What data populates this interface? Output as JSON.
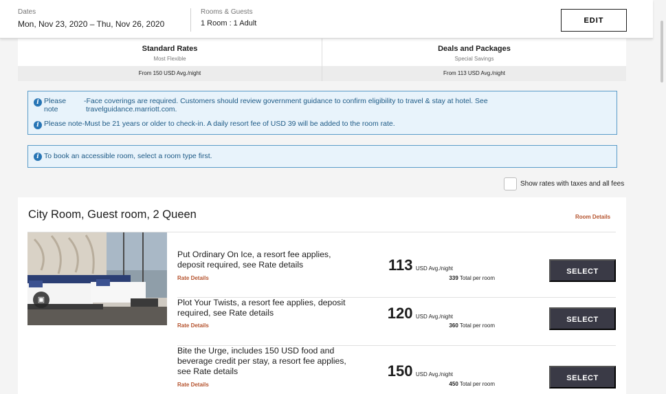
{
  "header": {
    "dates_label": "Dates",
    "dates_value": "Mon, Nov 23, 2020 – Thu, Nov 26, 2020",
    "rooms_label": "Rooms & Guests",
    "rooms_value": "1 Room : 1 Adult",
    "edit_label": "EDIT"
  },
  "tabs": [
    {
      "title": "Standard Rates",
      "subtitle": "Most Flexible",
      "from": "From 150 USD Avg./night"
    },
    {
      "title": "Deals and Packages",
      "subtitle": "Special Savings",
      "from": "From 113 USD Avg./night"
    }
  ],
  "notices": {
    "please_label_1": "Please",
    "please_label_2": "note",
    "covid_line_1": "-Face coverings are required. Customers should review government guidance to confirm eligibility to travel & stay at hotel. See",
    "covid_line_2": "travelguidance.marriott.com.",
    "age_note": "Please note-Must be 21 years or older to check-in. A daily resort fee of USD 39 will be added to the room rate.",
    "accessible": "To book an accessible room, select a room type first."
  },
  "tax_toggle_label": "Show rates with taxes and all fees",
  "room": {
    "title": "City Room, Guest room, 2 Queen",
    "details_link": "Room Details",
    "gallery_icon": "gallery-icon",
    "rates": [
      {
        "lines": [
          "Put Ordinary On Ice, a resort fee applies,",
          "deposit required, see Rate details"
        ],
        "link": "Rate Details",
        "price": "113",
        "unit": "USD Avg./night",
        "total": "339",
        "total_label": "Total per room",
        "select_label": "SELECT"
      },
      {
        "lines": [
          "Plot Your Twists, a resort fee applies, deposit",
          "required, see Rate details"
        ],
        "link": "Rate Details",
        "price": "120",
        "unit": "USD Avg./night",
        "total": "360",
        "total_label": "Total per room",
        "select_label": "SELECT"
      },
      {
        "lines": [
          "Bite the Urge, includes 150 USD food and",
          "beverage credit per stay, a resort fee applies,",
          "see Rate details"
        ],
        "link": "Rate Details",
        "price": "150",
        "unit": "USD Avg./night",
        "total": "450",
        "total_label": "Total per room",
        "select_label": "SELECT"
      }
    ]
  },
  "colors": {
    "accent_link": "#b5532e",
    "button_dark": "#3a3a46",
    "notice_bg": "#e8f3fb",
    "notice_border": "#5a9bc8",
    "info_icon": "#2775b5"
  }
}
